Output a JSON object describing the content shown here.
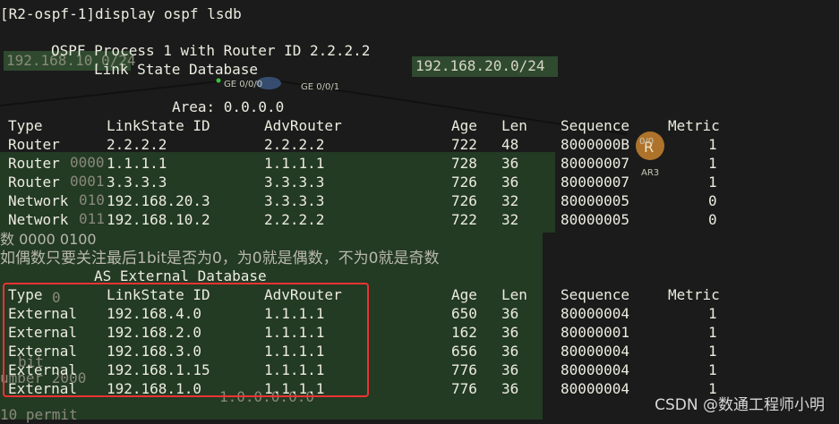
{
  "command": "[R2-ospf-1]display ospf lsdb",
  "process_line": "OSPF Process 1 with Router ID 2.2.2.2",
  "lsdb_title": "Link State Database",
  "area_line": "Area: 0.0.0.0",
  "columns": [
    "Type",
    "LinkState ID",
    "AdvRouter",
    "Age",
    "Len",
    "Sequence",
    "Metric"
  ],
  "area_rows": [
    [
      "Router",
      "2.2.2.2",
      "2.2.2.2",
      "722",
      "48",
      "8000000B",
      "1"
    ],
    [
      "Router",
      "1.1.1.1",
      "1.1.1.1",
      "728",
      "36",
      "80000007",
      "1"
    ],
    [
      "Router",
      "3.3.3.3",
      "3.3.3.3",
      "726",
      "36",
      "80000007",
      "1"
    ],
    [
      "Network",
      "192.168.20.3",
      "3.3.3.3",
      "726",
      "32",
      "80000005",
      "0"
    ],
    [
      "Network",
      "192.168.10.2",
      "2.2.2.2",
      "722",
      "32",
      "80000005",
      "0"
    ]
  ],
  "ext_title": "AS External Database",
  "ext_rows": [
    [
      "External",
      "192.168.4.0",
      "1.1.1.1",
      "650",
      "36",
      "80000004",
      "1"
    ],
    [
      "External",
      "192.168.2.0",
      "1.1.1.1",
      "162",
      "36",
      "80000001",
      "1"
    ],
    [
      "External",
      "192.168.3.0",
      "1.1.1.1",
      "656",
      "36",
      "80000004",
      "1"
    ],
    [
      "External",
      "192.168.1.15",
      "1.1.1.1",
      "776",
      "36",
      "80000004",
      "1"
    ],
    [
      "External",
      "192.168.1.0",
      "1.1.1.1",
      "776",
      "36",
      "80000004",
      "1"
    ]
  ],
  "overlay": {
    "net_left": "192.168.10.0/24",
    "net_right": "192.168.20.0/24",
    "port_a": "GE 0/0/0",
    "port_b": "GE 0/0/1",
    "port_c": "0/0",
    "device": "AR3",
    "bin_frag1": "0000",
    "bin_frag2": "0001",
    "bin_frag3": "010",
    "bin_frag4": "011",
    "bin_line": "数 0000 0100",
    "note": "如偶数只要关注最后1bit是否为0，为0就是偶数，不为0就是奇数",
    "frag_a": "0",
    "frag_b": "bit",
    "frag_c": "umber 2000",
    "frag_d": "1.0.0.0.0.0",
    "frag_e": "10 permit"
  },
  "watermark": "CSDN @数通工程师小明"
}
